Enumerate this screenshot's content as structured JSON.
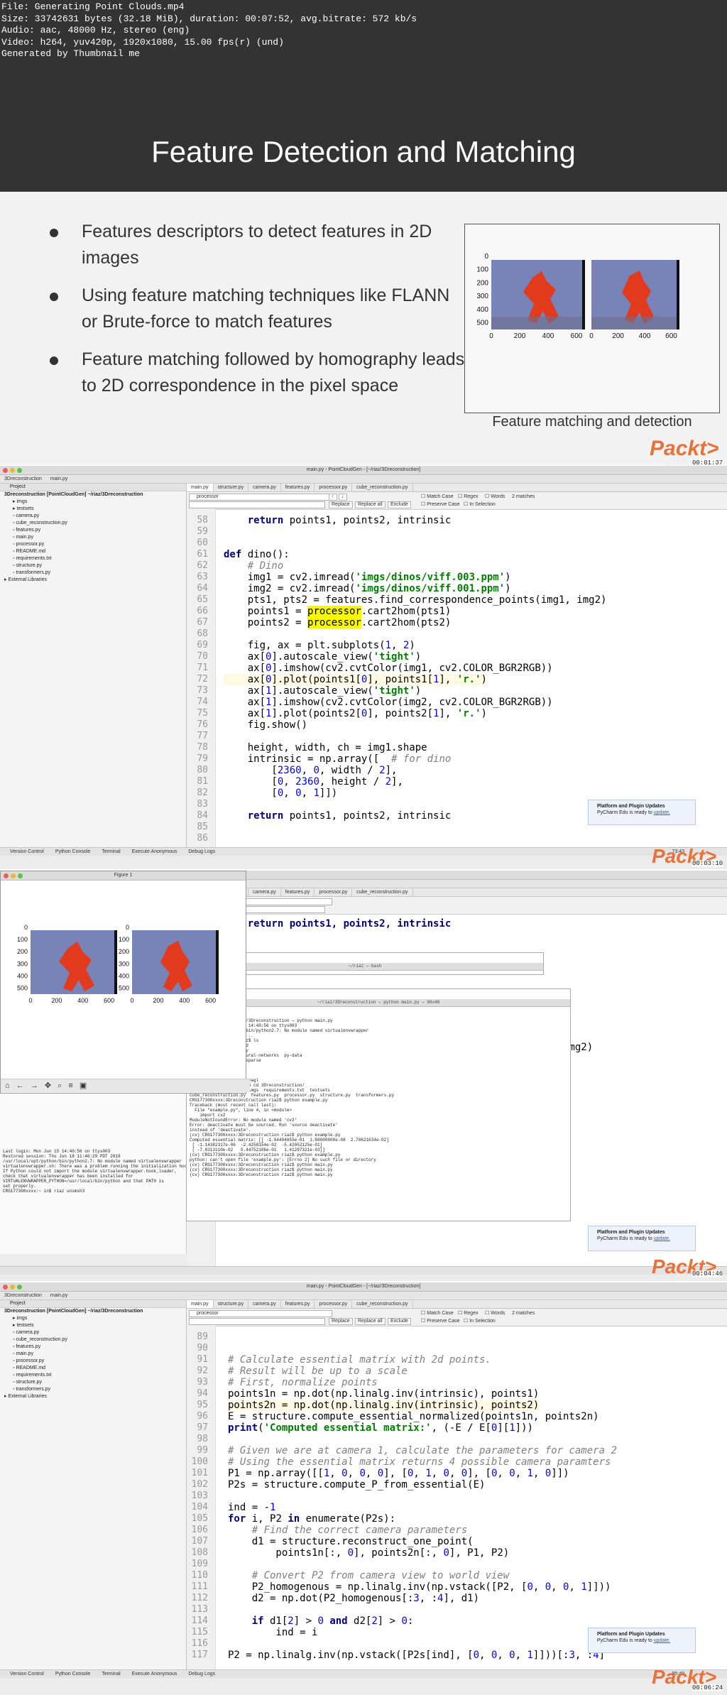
{
  "info": {
    "lines": [
      "File: Generating Point Clouds.mp4",
      "Size: 33742631 bytes (32.18 MiB), duration: 00:07:52, avg.bitrate: 572 kb/s",
      "Audio: aac, 48000 Hz, stereo (eng)",
      "Video: h264, yuv420p, 1920x1080, 15.00 fps(r) (und)",
      "Generated by Thumbnail me"
    ]
  },
  "slide": {
    "title": "Feature Detection and Matching",
    "bullets": [
      "Features descriptors to detect features in 2D images",
      "Using feature matching techniques like FLANN or Brute-force to match features",
      "Feature matching followed by homography leads to 2D correspondence in the pixel space"
    ],
    "figure_caption": "Feature matching and detection",
    "figure": {
      "y_ticks": [
        "0",
        "100",
        "200",
        "300",
        "400",
        "500"
      ],
      "x_ticks": [
        "0",
        "200",
        "400",
        "600"
      ]
    },
    "logo": "Packt>",
    "timestamp": "00:01:37"
  },
  "ide1": {
    "window_title": "main.py - PointCloudGen - [~/riaz/3Dreconstruction]",
    "breadcrumb": [
      "3Dreconstruction",
      "main.py"
    ],
    "project_label": "Project",
    "project_root": "3Dreconstruction [PointCloudGen] ~/riaz/3Dreconstruction",
    "tree": [
      "imgs",
      "testsets",
      "camera.py",
      "cube_reconstruction.py",
      "features.py",
      "main.py",
      "processor.py",
      "README.md",
      "requirements.txt",
      "structure.py",
      "transformers.py",
      "External Libraries"
    ],
    "tabs": [
      "main.py",
      "structure.py",
      "camera.py",
      "features.py",
      "processor.py",
      "cube_reconstruction.py"
    ],
    "search_value": "processor",
    "find_buttons": [
      "Replace",
      "Replace all",
      "Exclude"
    ],
    "find_options": [
      "Match Case",
      "Regex",
      "Words",
      "Preserve Case",
      "In Selection"
    ],
    "match_count": "2 matches",
    "line_numbers": [
      "58",
      "59",
      "60",
      "61",
      "62",
      "63",
      "64",
      "65",
      "66",
      "67",
      "68",
      "69",
      "70",
      "71",
      "72",
      "73",
      "74",
      "75",
      "76",
      "77",
      "78",
      "79",
      "80",
      "81",
      "82",
      "83",
      "84",
      "85",
      "86"
    ],
    "status_items": [
      "Version Control",
      "Python Console",
      "Terminal",
      "Execute Anonymous",
      "Debug Logs"
    ],
    "cursor_pos": "73:43",
    "notification_title": "Platform and Plugin Updates",
    "notification_text": "PyCharm Edu is ready to",
    "notification_link": "update.",
    "logo": "Packt>",
    "timestamp": "00:03:10"
  },
  "ide2": {
    "figure_title": "Figure 1",
    "figure": {
      "y_ticks": [
        "0",
        "100",
        "200",
        "300",
        "400",
        "500"
      ],
      "x_ticks": [
        "0",
        "200",
        "400",
        "600"
      ]
    },
    "terminal1_title": "~/riaz — bash",
    "terminal2_title": "~/riaz/3Dreconstruction — python main.py — 96x46",
    "terminal2_lines": [
      "riaz@CRG1763L — ~/riaz/3Dreconstruction — python main.py",
      "Last login: Mon Jun 15 14:40:56 on ttys003",
      "/usr/local/opt/python/bin/python2.7: No module named virtualenvwrapper",
      "CRG177300xxxx:~ in$ cd ..",
      "CRG177300xxxx:riaz riaz$ ls",
      "demo.jpg       pandas3d",
      "demo.txt       pheat.py",
      "emotion-recognition-neural-networks  py-data",
      "face_classification   sparse",
      "fashion        tvl.py",
      "homeServer.py  uploads",
      "notebooks      yolo",
      "opencv-eigenfaces     yyagl",
      "CRG177300xxxx:riaz riaz$ cd 3Dreconstruction/",
      "camera.py  example.py  imgs  requirements.txt  testsets",
      "cube_reconstruction.py  features.py  processor.py  structure.py  transformers.py",
      "CRG177300xxxx:3Dreconstruction riaz$ python example.py",
      "Traceback (most recent call last):",
      "  File \"example.py\", line 4, in <module>",
      "    import cv2",
      "ModuleNotFoundError: No module named 'cv2'",
      "Error: deactivate must be sourced. Run 'source deactivate'",
      "instead of 'deactivate'.",
      "(cv) CRG177300xxxx:3Dreconstruction riaz$ python example.py",
      "Computed essential matrix: [[ -1.64494655e-01  1.88000000e-08  2.70621634e-02]",
      " [ -1.14382317e-06  -2.4258154e-02  -5.42052125e-01]",
      " [ -7.8313110e-02   5.44752106e-01   1.41297321e-03]]",
      "(cv) CRG177300xxxx:3Dreconstruction riaz$ python example.py",
      "python: can't open file 'example.py': [Errno 2] No such file or directory",
      "(cv) CRG177300xxxx:3Dreconstruction riaz$ python main.py",
      "(cv) CRG177300xxxx:3Dreconstruction riaz$ python main.py",
      "(cv) CRG177300xxxx:3Dreconstruction riaz$ python main.py"
    ],
    "console_lines": [
      "Last login: Mon Jun 15 14:40:56 on ttys003",
      "Restored session: Thu Jun 18 11:46:29 PDT 2018",
      "/usr/local/opt/python/bin/python2.7: No module named virtualenvwrapper",
      "virtualenvwrapper.sh: There was a problem running the initialization hooks.",
      "",
      "If Python could not import the module virtualenvwrapper.hook_loader,",
      "check that virtualenvwrapper has been installed for",
      "VIRTUALENVWRAPPER_PYTHON=/usr/local/bin/python and that PATH is",
      "set properly.",
      "CRG177300xxxx:~ in$ riaz unsmsh3"
    ],
    "code_visible": [
      "return points1, points2, intrinsic",
      "img2)"
    ],
    "notification_title": "Platform and Plugin Updates",
    "notification_text": "PyCharm Edu is ready to",
    "notification_link": "update.",
    "logo": "Packt>",
    "timestamp": "00:04:46"
  },
  "ide3": {
    "window_title": "main.py - PointCloudGen - [~/riaz/3Dreconstruction]",
    "search_value": "processor",
    "line_numbers": [
      "89",
      "90",
      "91",
      "92",
      "93",
      "94",
      "95",
      "96",
      "97",
      "98",
      "99",
      "100",
      "101",
      "102",
      "103",
      "104",
      "105",
      "106",
      "107",
      "108",
      "109",
      "110",
      "111",
      "112",
      "113",
      "114",
      "115",
      "116",
      "117"
    ],
    "cursor_pos": "95:49",
    "notification_title": "Platform and Plugin Updates",
    "notification_text": "PyCharm Edu is ready to",
    "notification_link": "update.",
    "logo": "Packt>",
    "timestamp": "00:06:24"
  }
}
